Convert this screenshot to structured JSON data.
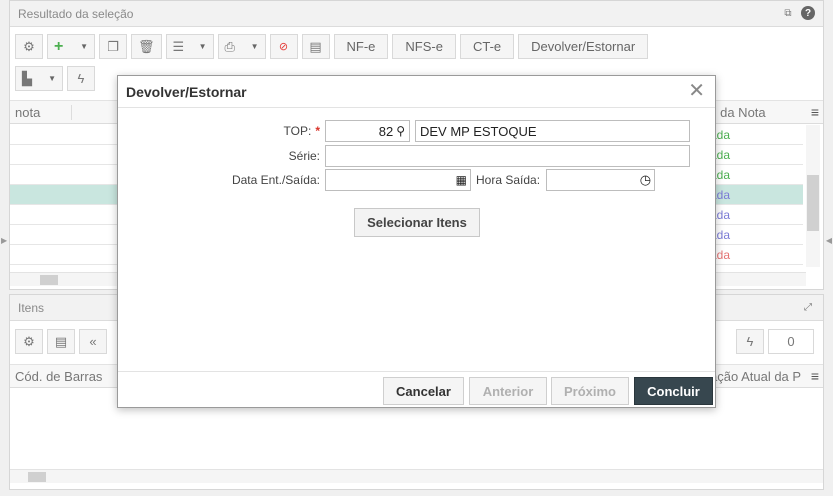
{
  "results_panel": {
    "title": "Resultado da seleção",
    "toolbar_text_buttons": [
      "NF-e",
      "NFS-e",
      "CT-e",
      "Devolver/Estornar"
    ],
    "columns": {
      "nota": "nota",
      "status_col": "s da Nota"
    },
    "rows": [
      {
        "status": "ada",
        "color": "#4caf50"
      },
      {
        "status": "ada",
        "color": "#4caf50"
      },
      {
        "status": "ada",
        "color": "#4caf50"
      },
      {
        "status": "ada",
        "color": "#7b7bd6"
      },
      {
        "status": "ada",
        "color": "#7b7bd6"
      },
      {
        "status": "ada",
        "color": "#7b7bd6"
      },
      {
        "status": "ada",
        "color": "#e57373"
      }
    ]
  },
  "items_panel": {
    "title": "Itens",
    "col_barcode": "Cód. de Barras",
    "col_location": "ação Atual da P",
    "page_value": "0"
  },
  "modal": {
    "title": "Devolver/Estornar",
    "top_label": "TOP:",
    "top_code": "82",
    "top_description": "DEV MP ESTOQUE",
    "serie_label": "Série:",
    "serie_value": "",
    "date_label": "Data Ent./Saída:",
    "date_value": "",
    "time_label": "Hora Saída:",
    "time_value": "",
    "select_items_button": "Selecionar Itens",
    "cancel_button": "Cancelar",
    "previous_button": "Anterior",
    "next_button": "Próximo",
    "finish_button": "Concluir"
  }
}
